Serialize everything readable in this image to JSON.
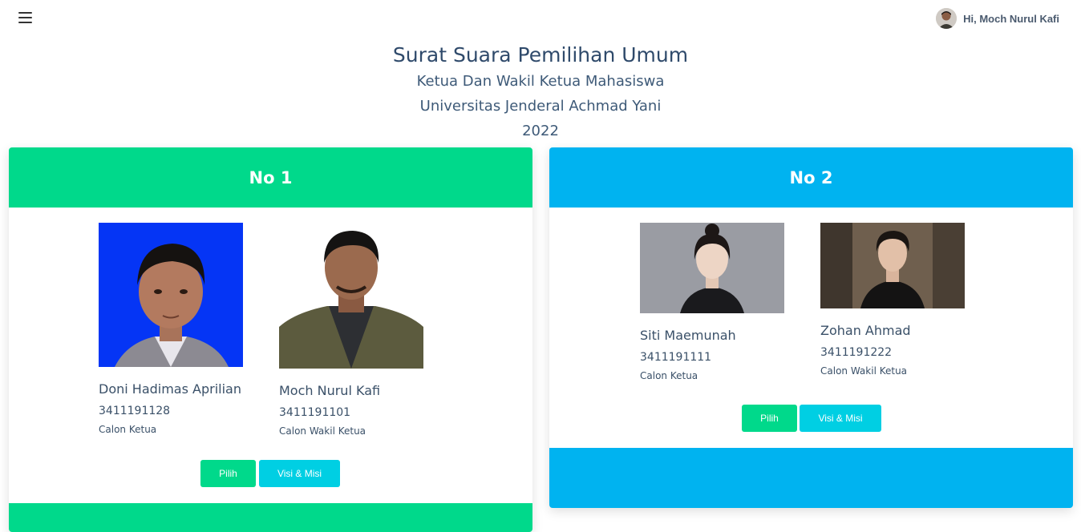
{
  "header": {
    "user_greeting": "Hi, Moch Nurul Kafi"
  },
  "heading": {
    "title": "Surat Suara Pemilihan Umum",
    "line1": "Ketua Dan Wakil Ketua Mahasiswa",
    "line2": "Universitas Jenderal Achmad Yani",
    "year": "2022"
  },
  "colors": {
    "green": "#00d98b",
    "blue": "#00b3f0",
    "cyan_button": "#00cfe3"
  },
  "candidates": [
    {
      "number_label": "No 1",
      "chair": {
        "name": "Doni Hadimas Aprilian",
        "nim": "3411191128",
        "role": "Calon Ketua"
      },
      "vice": {
        "name": "Moch Nurul Kafi",
        "nim": "3411191101",
        "role": "Calon Wakil Ketua"
      },
      "vote_label": "Pilih",
      "vision_label": "Visi & Misi"
    },
    {
      "number_label": "No 2",
      "chair": {
        "name": "Siti Maemunah",
        "nim": "3411191111",
        "role": "Calon Ketua"
      },
      "vice": {
        "name": "Zohan Ahmad",
        "nim": "3411191222",
        "role": "Calon Wakil Ketua"
      },
      "vote_label": "Pilih",
      "vision_label": "Visi & Misi"
    }
  ]
}
